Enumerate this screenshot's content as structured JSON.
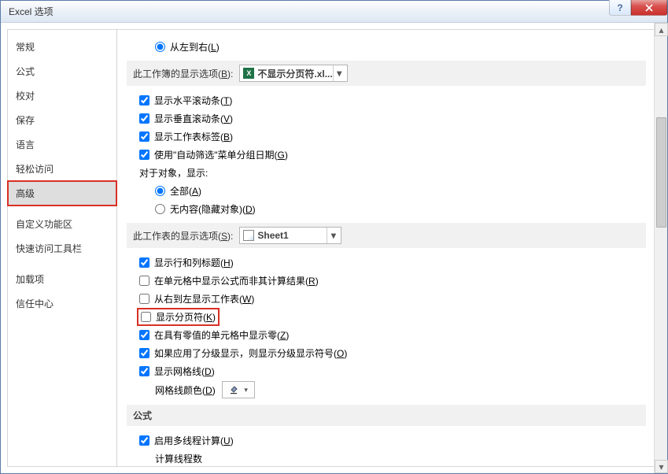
{
  "window": {
    "title": "Excel 选项"
  },
  "sidebar": {
    "items": [
      {
        "label": "常规"
      },
      {
        "label": "公式"
      },
      {
        "label": "校对"
      },
      {
        "label": "保存"
      },
      {
        "label": "语言"
      },
      {
        "label": "轻松访问"
      },
      {
        "label": "高级",
        "selected": true,
        "highlight": true
      },
      {
        "label": "自定义功能区"
      },
      {
        "label": "快速访问工具栏"
      },
      {
        "label": "加载项"
      },
      {
        "label": "信任中心"
      }
    ]
  },
  "content": {
    "topRadio": {
      "label": "从左到右",
      "hot": "L"
    },
    "groupWorkbook": {
      "label": "此工作簿的显示选项",
      "hot": "B",
      "comboText": "不显示分页符.xl..."
    },
    "wb": {
      "hscroll": {
        "label": "显示水平滚动条",
        "hot": "T",
        "checked": true
      },
      "vscroll": {
        "label": "显示垂直滚动条",
        "hot": "V",
        "checked": true
      },
      "tabs": {
        "label": "显示工作表标签",
        "hot": "B",
        "checked": true
      },
      "autofilt": {
        "label": "使用\"自动筛选\"菜单分组日期",
        "hot": "G",
        "checked": true
      },
      "objlabel": "对于对象，显示:",
      "radioAll": {
        "label": "全部",
        "hot": "A",
        "checked": true
      },
      "radioNone": {
        "label": "无内容(隐藏对象)",
        "hot": "D",
        "checked": false
      }
    },
    "groupSheet": {
      "label": "此工作表的显示选项",
      "hot": "S",
      "comboText": "Sheet1"
    },
    "sheet": {
      "rowcol": {
        "label": "显示行和列标题",
        "hot": "H",
        "checked": true
      },
      "formulas": {
        "label": "在单元格中显示公式而非其计算结果",
        "hot": "R",
        "checked": false
      },
      "rtl": {
        "label": "从右到左显示工作表",
        "hot": "W",
        "checked": false
      },
      "pagebreak": {
        "label": "显示分页符",
        "hot": "K",
        "checked": false,
        "highlight": true
      },
      "zeros": {
        "label": "在具有零值的单元格中显示零",
        "hot": "Z",
        "checked": true
      },
      "outline": {
        "label": "如果应用了分级显示，则显示分级显示符号",
        "hot": "O",
        "checked": true
      },
      "gridlines": {
        "label": "显示网格线",
        "hot": "D",
        "checked": true
      },
      "gridcolor": {
        "label": "网格线颜色",
        "hot": "D"
      }
    },
    "groupFormula": "公式",
    "formula": {
      "multi": {
        "label": "启用多线程计算",
        "hot": "U",
        "checked": true
      },
      "threads": "计算线程数"
    }
  }
}
